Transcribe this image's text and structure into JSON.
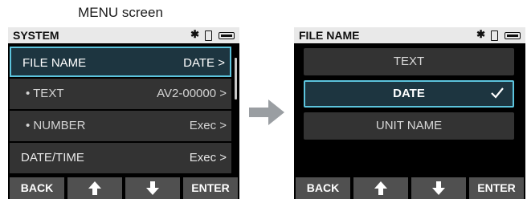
{
  "caption": "MENU screen",
  "left_screen": {
    "status_title": "SYSTEM",
    "bluetooth_icon": "bluetooth-icon",
    "rows": [
      {
        "label": "FILE NAME",
        "value": "DATE >"
      },
      {
        "label": "• TEXT",
        "value": "AV2-00000 >"
      },
      {
        "label": "• NUMBER",
        "value": "Exec >"
      },
      {
        "label": "DATE/TIME",
        "value": "Exec >"
      }
    ],
    "buttons": {
      "back": "BACK",
      "enter": "ENTER"
    }
  },
  "right_screen": {
    "status_title": "FILE NAME",
    "options": [
      "TEXT",
      "DATE",
      "UNIT NAME"
    ],
    "selected_option": "DATE",
    "buttons": {
      "back": "BACK",
      "enter": "ENTER"
    }
  },
  "colors": {
    "selection_border": "#5cc4dd",
    "selection_fill": "#1d3540",
    "row_fill": "#333333",
    "button_fill": "#505050",
    "arrow": "#9a9ea2"
  }
}
